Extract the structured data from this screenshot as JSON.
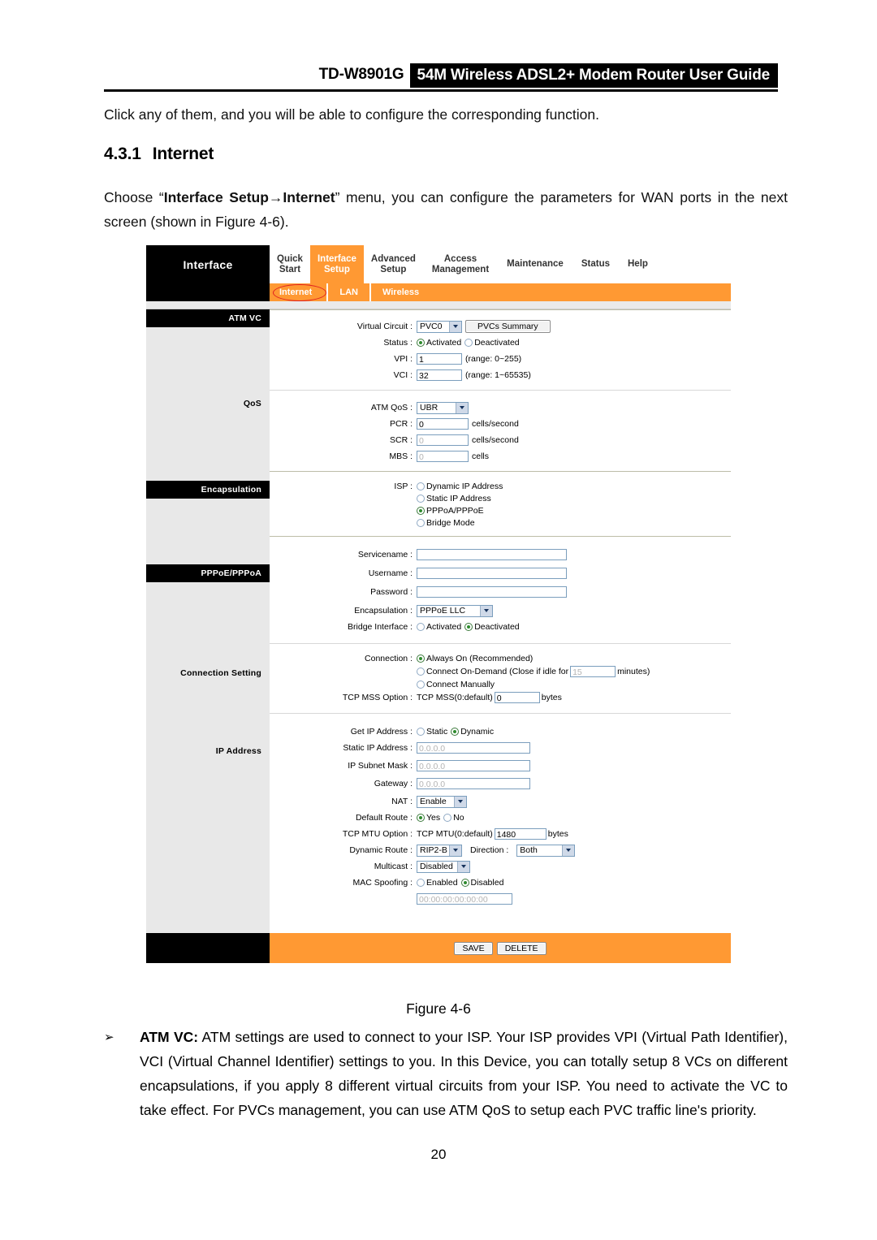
{
  "doc": {
    "model": "TD-W8901G",
    "title": "54M Wireless ADSL2+ Modem Router User Guide",
    "intro_paragraph": "Click any of them, and you will be able to configure the corresponding function.",
    "section_number": "4.3.1",
    "section_title": "Internet",
    "choose_prefix": "Choose “",
    "choose_bold": "Interface Setup→Internet",
    "choose_suffix": "” menu, you can configure the parameters for WAN ports in the next screen (shown in Figure 4-6).",
    "figure_caption": "Figure 4-6",
    "bullet_marker": "➢",
    "bullet_bold": "ATM VC:",
    "bullet_text": " ATM settings are used to connect to your ISP. Your ISP provides VPI (Virtual Path Identifier), VCI (Virtual Channel Identifier) settings to you. In this Device, you can totally setup 8 VCs on different encapsulations, if you apply 8 different virtual circuits from your ISP. You need to activate the VC to take effect. For PVCs management, you can use ATM QoS to setup each PVC traffic line's priority.",
    "page_number": "20"
  },
  "colors": {
    "accent_orange": "#FF9933",
    "sidebar_grey": "#E8E8E8",
    "black": "#000000",
    "annotation_red": "#E02020",
    "input_border": "#7B9EBD"
  },
  "router": {
    "brand_label": "Interface",
    "main_tabs": [
      {
        "label_top": "Quick",
        "label_bottom": "Start",
        "active": false
      },
      {
        "label_top": "Interface",
        "label_bottom": "Setup",
        "active": true
      },
      {
        "label_top": "Advanced",
        "label_bottom": "Setup",
        "active": false
      },
      {
        "label_top": "Access",
        "label_bottom": "Management",
        "active": false
      },
      {
        "label_top": "Maintenance",
        "label_bottom": "",
        "active": false
      },
      {
        "label_top": "Status",
        "label_bottom": "",
        "active": false
      },
      {
        "label_top": "Help",
        "label_bottom": "",
        "active": false
      }
    ],
    "sub_tabs": [
      {
        "label": "Internet",
        "selected": true,
        "annotated": true
      },
      {
        "label": "LAN",
        "selected": false,
        "annotated": false
      },
      {
        "label": "Wireless",
        "selected": false,
        "annotated": false
      }
    ],
    "sections": {
      "atm_vc": {
        "sidebar_label": "ATM VC",
        "virtual_circuit_label": "Virtual Circuit :",
        "virtual_circuit_value": "PVC0",
        "pvcs_summary_button": "PVCs Summary",
        "status_label": "Status :",
        "status_activated": "Activated",
        "status_deactivated": "Deactivated",
        "status_selected": "Activated",
        "vpi_label": "VPI :",
        "vpi_value": "1",
        "vpi_range": "(range: 0~255)",
        "vci_label": "VCI :",
        "vci_value": "32",
        "vci_range": "(range: 1~65535)"
      },
      "qos": {
        "sidebar_label": "QoS",
        "atm_qos_label": "ATM QoS :",
        "atm_qos_value": "UBR",
        "pcr_label": "PCR :",
        "pcr_value": "0",
        "pcr_unit": "cells/second",
        "scr_label": "SCR :",
        "scr_value": "0",
        "scr_unit": "cells/second",
        "mbs_label": "MBS :",
        "mbs_value": "0",
        "mbs_unit": "cells"
      },
      "encapsulation": {
        "sidebar_label": "Encapsulation",
        "isp_label": "ISP :",
        "options": [
          "Dynamic IP Address",
          "Static IP Address",
          "PPPoA/PPPoE",
          "Bridge Mode"
        ],
        "selected": "PPPoA/PPPoE"
      },
      "pppoe_pppoa": {
        "sidebar_label": "PPPoE/PPPoA",
        "servicename_label": "Servicename :",
        "servicename_value": "",
        "username_label": "Username :",
        "username_value": "",
        "password_label": "Password :",
        "password_value": "",
        "encapsulation_label": "Encapsulation :",
        "encapsulation_value": "PPPoE LLC",
        "bridge_interface_label": "Bridge Interface :",
        "bridge_activated": "Activated",
        "bridge_deactivated": "Deactivated",
        "bridge_selected": "Deactivated"
      },
      "connection_setting": {
        "sidebar_label": "Connection Setting",
        "connection_label": "Connection :",
        "option_always_on": "Always On (Recommended)",
        "option_on_demand_pre": "Connect On-Demand (Close if idle for",
        "on_demand_idle_value": "15",
        "option_on_demand_post": "minutes)",
        "option_manual": "Connect Manually",
        "connection_selected": "Always On (Recommended)",
        "tcp_mss_label": "TCP MSS Option :",
        "tcp_mss_prefix": "TCP MSS(0:default)",
        "tcp_mss_value": "0",
        "tcp_mss_unit": "bytes"
      },
      "ip_address": {
        "sidebar_label": "IP Address",
        "get_ip_label": "Get IP Address :",
        "get_ip_static": "Static",
        "get_ip_dynamic": "Dynamic",
        "get_ip_selected": "Dynamic",
        "static_ip_label": "Static IP Address :",
        "static_ip_value": "0.0.0.0",
        "subnet_label": "IP Subnet Mask :",
        "subnet_value": "0.0.0.0",
        "gateway_label": "Gateway :",
        "gateway_value": "0.0.0.0",
        "nat_label": "NAT :",
        "nat_value": "Enable",
        "default_route_label": "Default Route :",
        "default_route_yes": "Yes",
        "default_route_no": "No",
        "default_route_selected": "Yes",
        "tcp_mtu_label": "TCP MTU Option :",
        "tcp_mtu_prefix": "TCP MTU(0:default)",
        "tcp_mtu_value": "1480",
        "tcp_mtu_unit": "bytes",
        "dynamic_route_label": "Dynamic Route :",
        "dynamic_route_value": "RIP2-B",
        "direction_label": "Direction :",
        "direction_value": "Both",
        "multicast_label": "Multicast :",
        "multicast_value": "Disabled",
        "mac_spoofing_label": "MAC Spoofing :",
        "mac_enabled": "Enabled",
        "mac_disabled": "Disabled",
        "mac_selected": "Disabled",
        "mac_value": "00:00:00:00:00:00"
      }
    },
    "footer": {
      "save_button": "SAVE",
      "delete_button": "DELETE"
    }
  }
}
